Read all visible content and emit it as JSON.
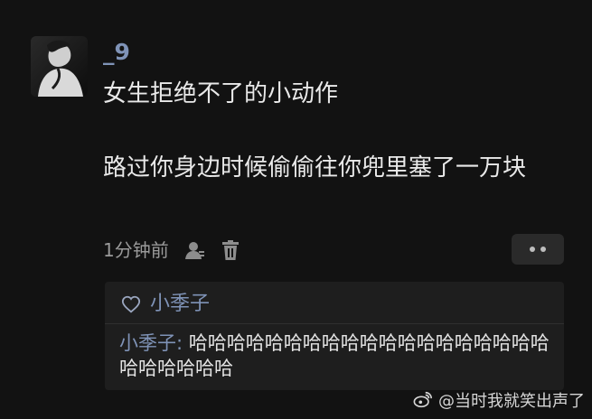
{
  "post": {
    "username": "_9",
    "text_line1": "女生拒绝不了的小动作",
    "text_line2": "路过你身边时候偷偷往你兜里塞了一万块",
    "timestamp": "1分钟前",
    "icons": {
      "avatar": "avatar-image",
      "user": "user-icon",
      "delete": "trash-icon",
      "more": "more-icon"
    }
  },
  "reply": {
    "author": "小季子",
    "author_inline": "小季子:",
    "content": " 哈哈哈哈哈哈哈哈哈哈哈哈哈哈哈哈哈哈哈哈哈哈哈哈哈",
    "icon": "heart-outline-icon"
  },
  "watermark": {
    "text": "@当时我就笑出声了",
    "icon": "weibo-icon"
  },
  "colors": {
    "background": "#121212",
    "username": "#7f93b7",
    "text": "#e9e9e9",
    "muted": "#9a9a9a",
    "reply_bg": "#1e1e1e"
  }
}
